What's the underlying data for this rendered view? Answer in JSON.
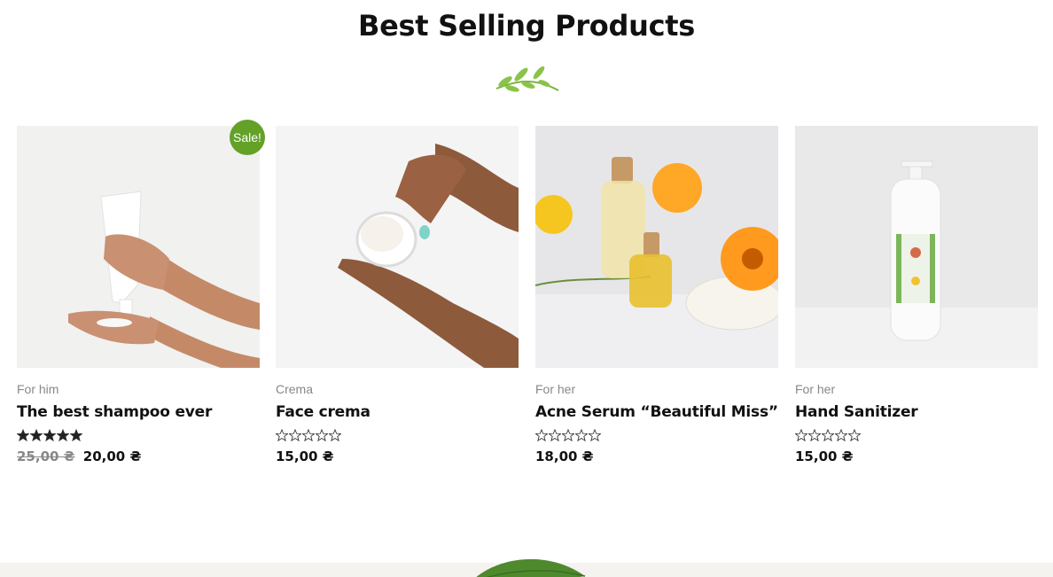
{
  "section": {
    "title": "Best Selling Products",
    "divider_icon": "leaf-sprig-icon",
    "accent": "#63a127"
  },
  "products": [
    {
      "category": "For him",
      "title": "The best shampoo ever",
      "rating": 5,
      "rating_max": 5,
      "sale_badge": "Sale!",
      "old_price": "25,00 ₴",
      "price": "20,00 ₴"
    },
    {
      "category": "Crema",
      "title": "Face crema",
      "rating": 0,
      "rating_max": 5,
      "price": "15,00 ₴"
    },
    {
      "category": "For her",
      "title": "Acne Serum “Beautiful Miss”",
      "rating": 0,
      "rating_max": 5,
      "price": "18,00 ₴"
    },
    {
      "category": "For her",
      "title": "Hand Sanitizer",
      "rating": 0,
      "rating_max": 5,
      "price": "15,00 ₴"
    }
  ],
  "footer": {
    "decor_icon": "basil-leaf-icon",
    "band_color": "#f4f3ef"
  }
}
